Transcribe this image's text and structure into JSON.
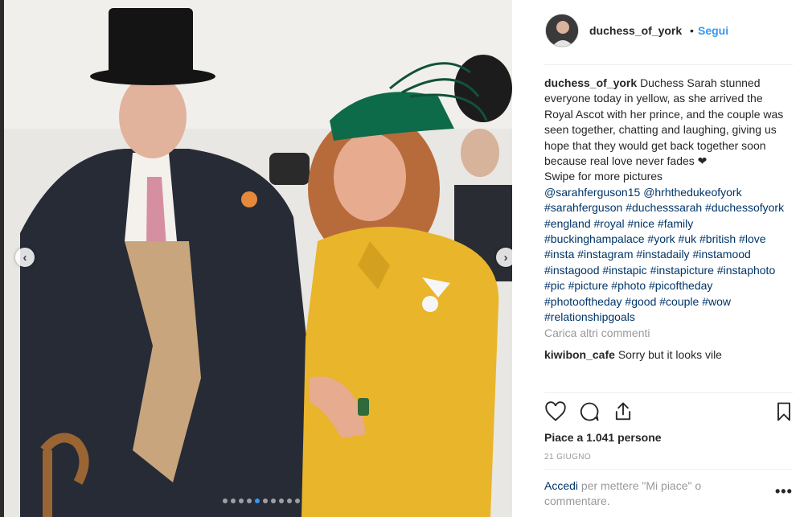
{
  "post": {
    "username": "duchess_of_york",
    "separator": "•",
    "follow_label": "Segui",
    "caption_text": "Duchess Sarah stunned everyone today in yellow, as she arrived the Royal Ascot with her prince, and the couple was seen together, chatting and laughing, giving us hope that they would get back together soon because real love never fades ❤",
    "caption_line2": "Swipe for more pictures",
    "mentions": [
      "@sarahferguson15",
      "@hrhthedukeofyork"
    ],
    "hashtags": [
      "#sarahferguson",
      "#duchesssarah",
      "#duchessofyork",
      "#england",
      "#royal",
      "#nice",
      "#family",
      "#buckinghampalace",
      "#york",
      "#uk",
      "#british",
      "#love",
      "#insta",
      "#instagram",
      "#instadaily",
      "#instamood",
      "#instagood",
      "#instapic",
      "#instapicture",
      "#instaphoto",
      "#pic",
      "#picture",
      "#photo",
      "#picoftheday",
      "#photooftheday",
      "#good",
      "#couple",
      "#wow",
      "#relationshipgoals"
    ],
    "load_more_comments": "Carica altri commenti",
    "first_comment": {
      "user": "kiwibon_cafe",
      "text": "Sorry but it looks vile"
    },
    "likes_text": "Piace a 1.041 persone",
    "date": "21 GIUGNO",
    "login_link": "Accedi",
    "login_text": "per mettere \"Mi piace\" o commentare.",
    "more_options": "•••"
  },
  "carousel": {
    "total_slides": 10,
    "active_index": 4,
    "active_color": "#3897f0"
  },
  "icons": {
    "like": "heart-icon",
    "comment": "comment-bubble-icon",
    "share": "share-icon",
    "save": "bookmark-icon",
    "prev": "chevron-left-icon",
    "next": "chevron-right-icon"
  },
  "colors": {
    "link_blue": "#3897f0",
    "hashtag": "#003569",
    "muted": "#999999",
    "text": "#262626"
  }
}
